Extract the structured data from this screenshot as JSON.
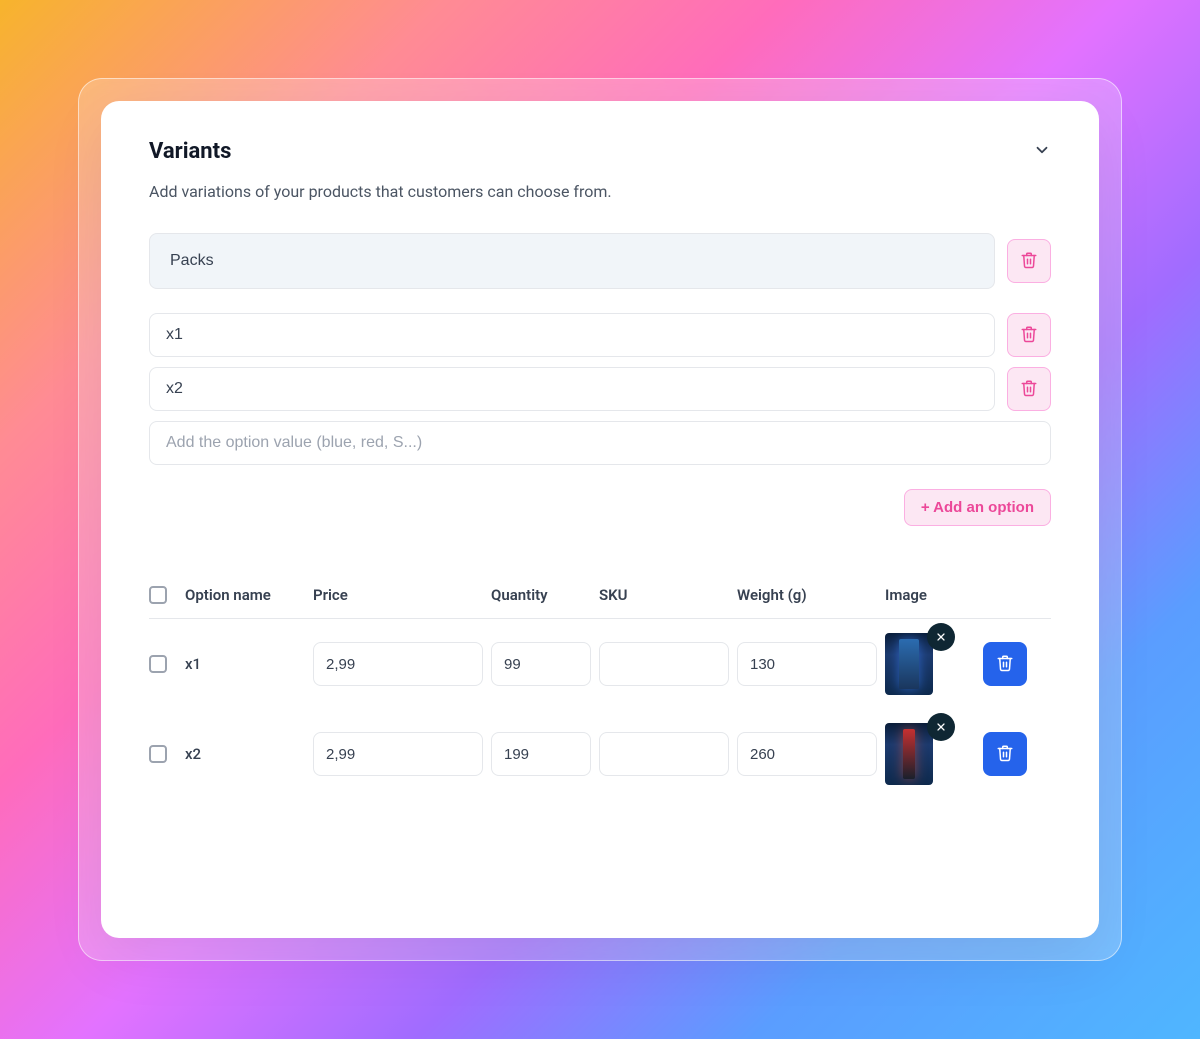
{
  "header": {
    "title": "Variants",
    "subtitle": "Add variations of your products that customers can choose from."
  },
  "option": {
    "name": "Packs",
    "values": [
      "x1",
      "x2"
    ],
    "new_value_placeholder": "Add the option value (blue, red, S...)",
    "add_option_label": "+ Add an option"
  },
  "table": {
    "headers": {
      "option_name": "Option name",
      "price": "Price",
      "quantity": "Quantity",
      "sku": "SKU",
      "weight": "Weight (g)",
      "image": "Image"
    },
    "rows": [
      {
        "name": "x1",
        "price": "2,99",
        "quantity": "99",
        "sku": "",
        "weight": "130"
      },
      {
        "name": "x2",
        "price": "2,99",
        "quantity": "199",
        "sku": "",
        "weight": "260"
      }
    ]
  },
  "icons": {
    "trash": "trash-icon",
    "close": "close-icon",
    "chevron": "chevron-down-icon"
  }
}
